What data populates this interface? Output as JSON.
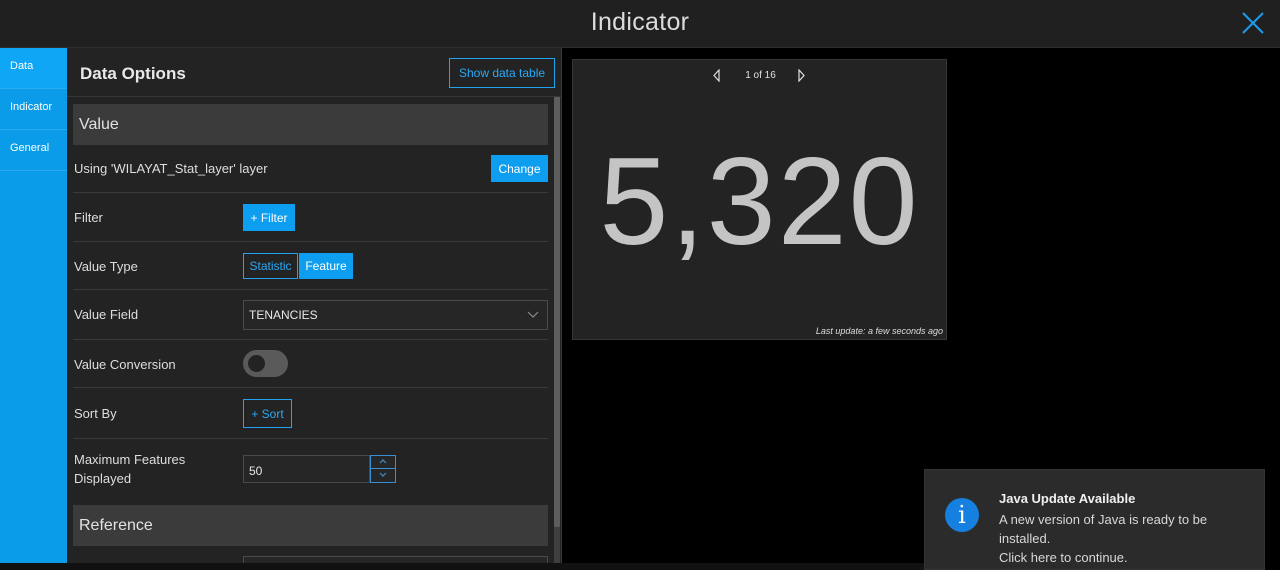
{
  "header": {
    "title": "Indicator"
  },
  "tabs": [
    {
      "label": "Data",
      "active": true
    },
    {
      "label": "Indicator",
      "active": false
    },
    {
      "label": "General",
      "active": false
    }
  ],
  "panel": {
    "title": "Data Options",
    "show_table_label": "Show data table",
    "value_section": "Value",
    "layer_text": "Using 'WILAYAT_Stat_layer' layer",
    "change_label": "Change",
    "filter_label": "Filter",
    "filter_button": "+ Filter",
    "value_type_label": "Value Type",
    "value_type_options": [
      "Statistic",
      "Feature"
    ],
    "value_type_selected": "Feature",
    "value_field_label": "Value Field",
    "value_field_value": "TENANCIES",
    "value_conversion_label": "Value Conversion",
    "value_conversion_on": false,
    "sort_label": "Sort By",
    "sort_button": "+ Sort",
    "max_features_label_1": "Maximum Features",
    "max_features_label_2": "Displayed",
    "max_features_value": "50",
    "reference_section": "Reference"
  },
  "preview": {
    "pager_text": "1 of 16",
    "value": "5,320",
    "last_update": "Last update: a few seconds ago"
  },
  "toast": {
    "icon": "info-icon",
    "title": "Java Update Available",
    "line1": "A new version of Java is ready to be",
    "line2": "installed.",
    "line3": "Click here to continue."
  },
  "colors": {
    "accent": "#0a9ce8",
    "panel_bg": "#232323",
    "header_bg": "#202020"
  }
}
